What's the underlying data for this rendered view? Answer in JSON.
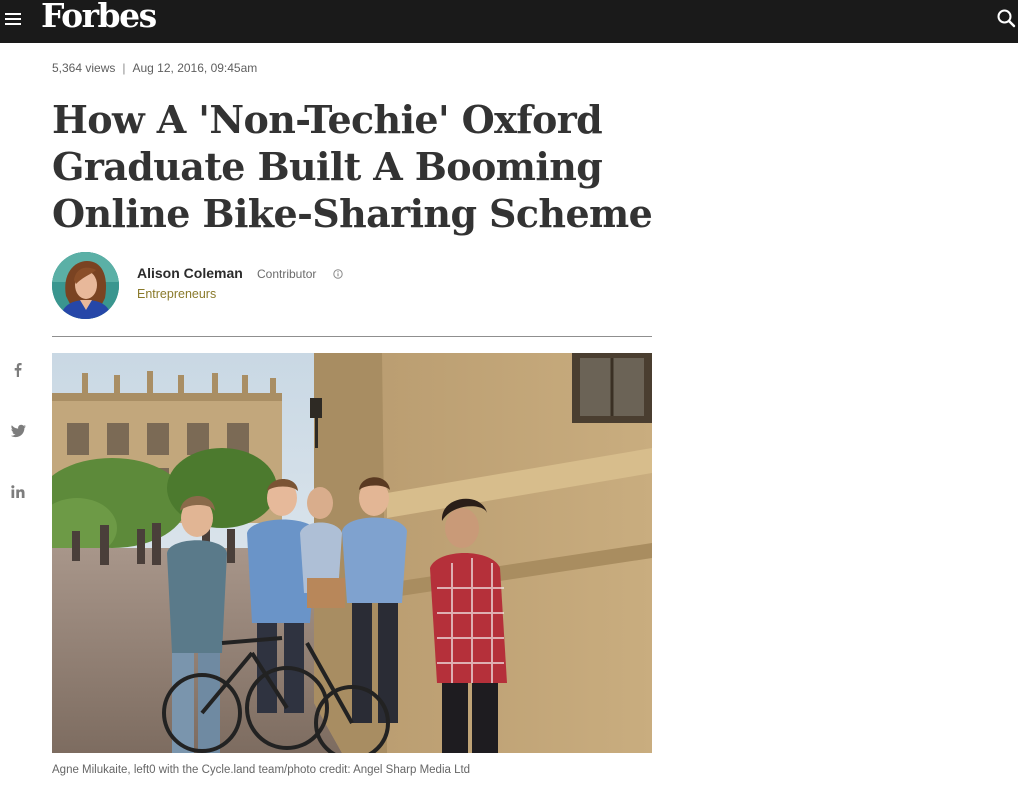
{
  "header": {
    "logo_text": "Forbes",
    "menu_icon": "hamburger-menu-icon",
    "search_icon": "search-icon",
    "background": "#1a1a1a"
  },
  "article": {
    "views": "5,364 views",
    "separator": "|",
    "date": "Aug 12, 2016, 09:45am",
    "headline": "How A 'Non-Techie' Oxford Graduate Built A Booming Online Bike-Sharing Scheme",
    "author": {
      "name": "Alison Coleman",
      "role": "Contributor",
      "info_icon": "info-icon",
      "channel": "Entrepreneurs",
      "channel_color": "#8a7a2b"
    },
    "share": {
      "facebook_icon": "facebook-icon",
      "twitter_icon": "twitter-icon",
      "linkedin_icon": "linkedin-icon"
    },
    "image_caption": "Agne Milukaite, left0 with the Cycle.land team/photo credit: Angel Sharp Media Ltd"
  }
}
